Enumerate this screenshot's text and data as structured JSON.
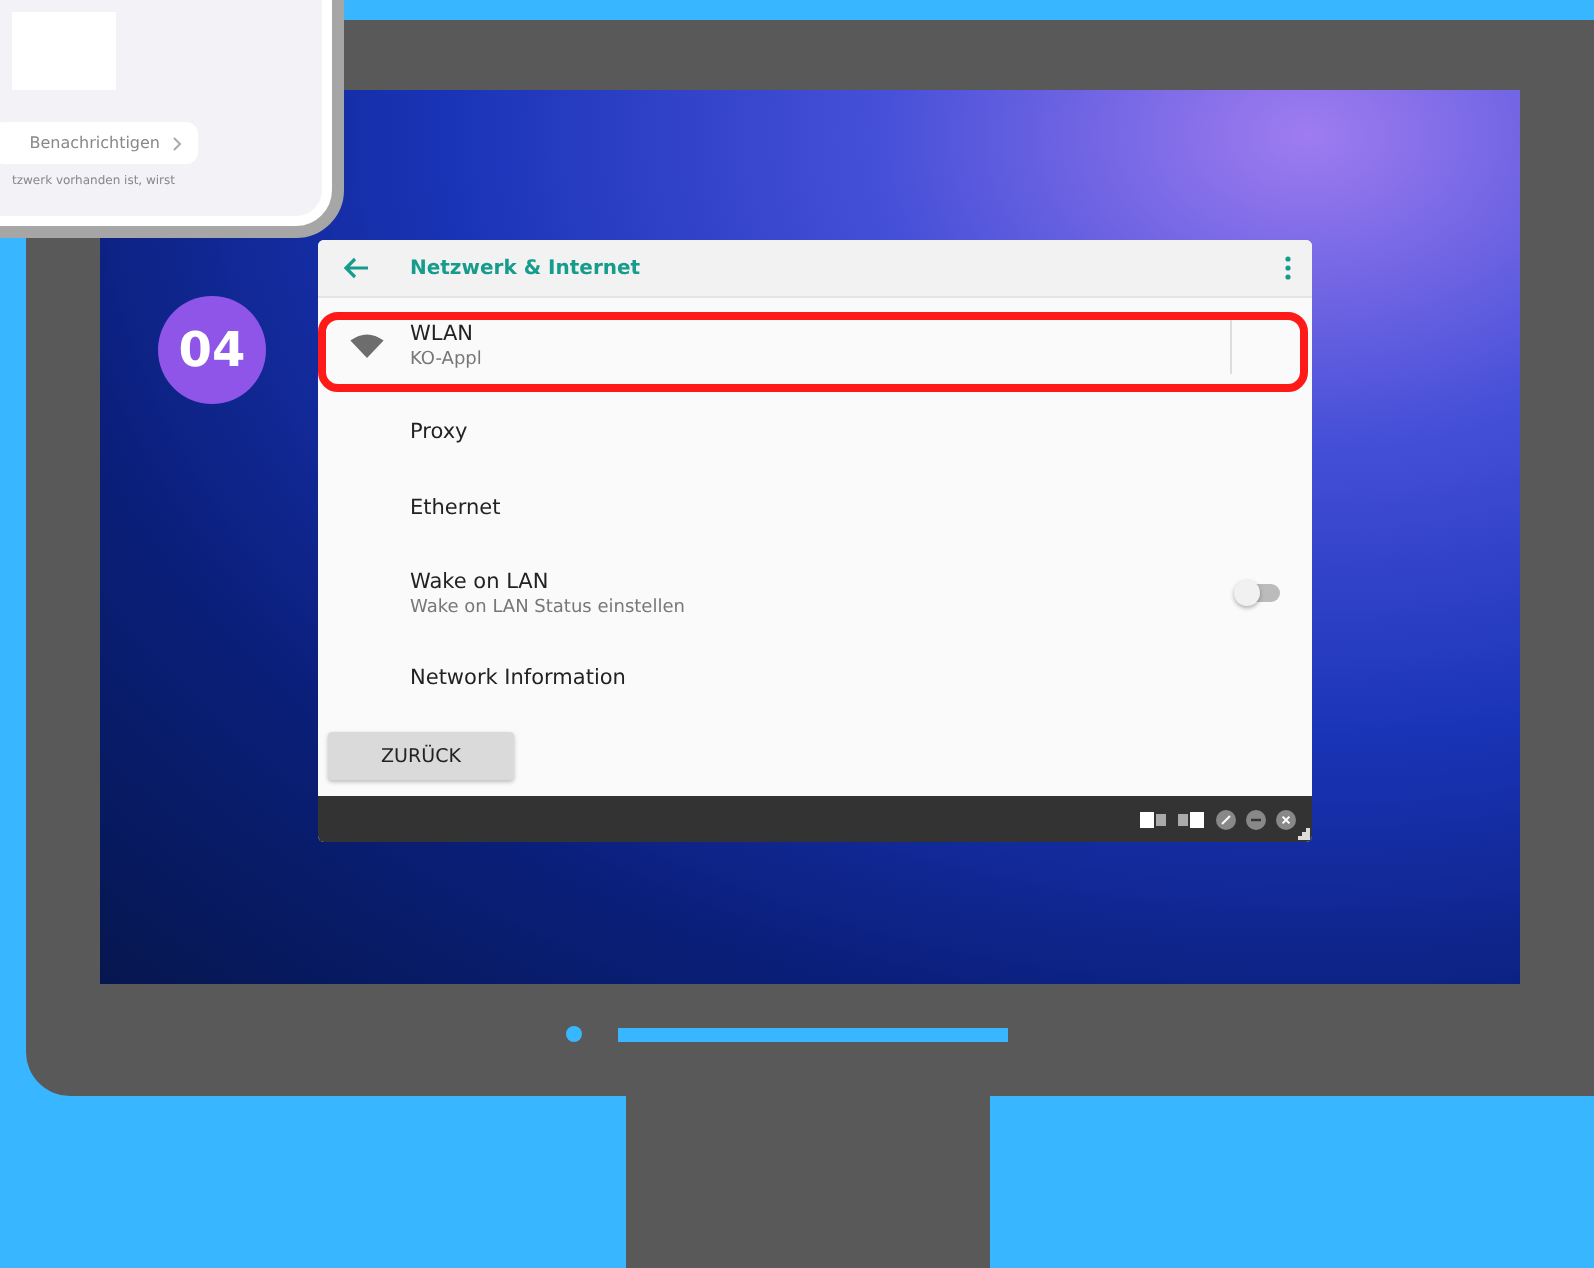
{
  "phone_panel": {
    "action": "Benachrichtigen",
    "note": "tzwerk vorhanden ist, wirst"
  },
  "step_badge": "04",
  "window": {
    "title": "Netzwerk & Internet",
    "items": [
      {
        "kind": "wifi",
        "title": "WLAN",
        "subtitle": "KO-Appl",
        "highlighted": true
      },
      {
        "kind": "plain",
        "title": "Proxy",
        "highlighted": false
      },
      {
        "kind": "plain",
        "title": "Ethernet",
        "highlighted": false
      },
      {
        "kind": "toggle",
        "title": "Wake on LAN",
        "subtitle": "Wake on LAN Status einstellen",
        "on": false,
        "highlighted": false
      },
      {
        "kind": "plain",
        "title": "Network Information",
        "highlighted": false
      }
    ],
    "back_button": "ZURÜCK"
  }
}
